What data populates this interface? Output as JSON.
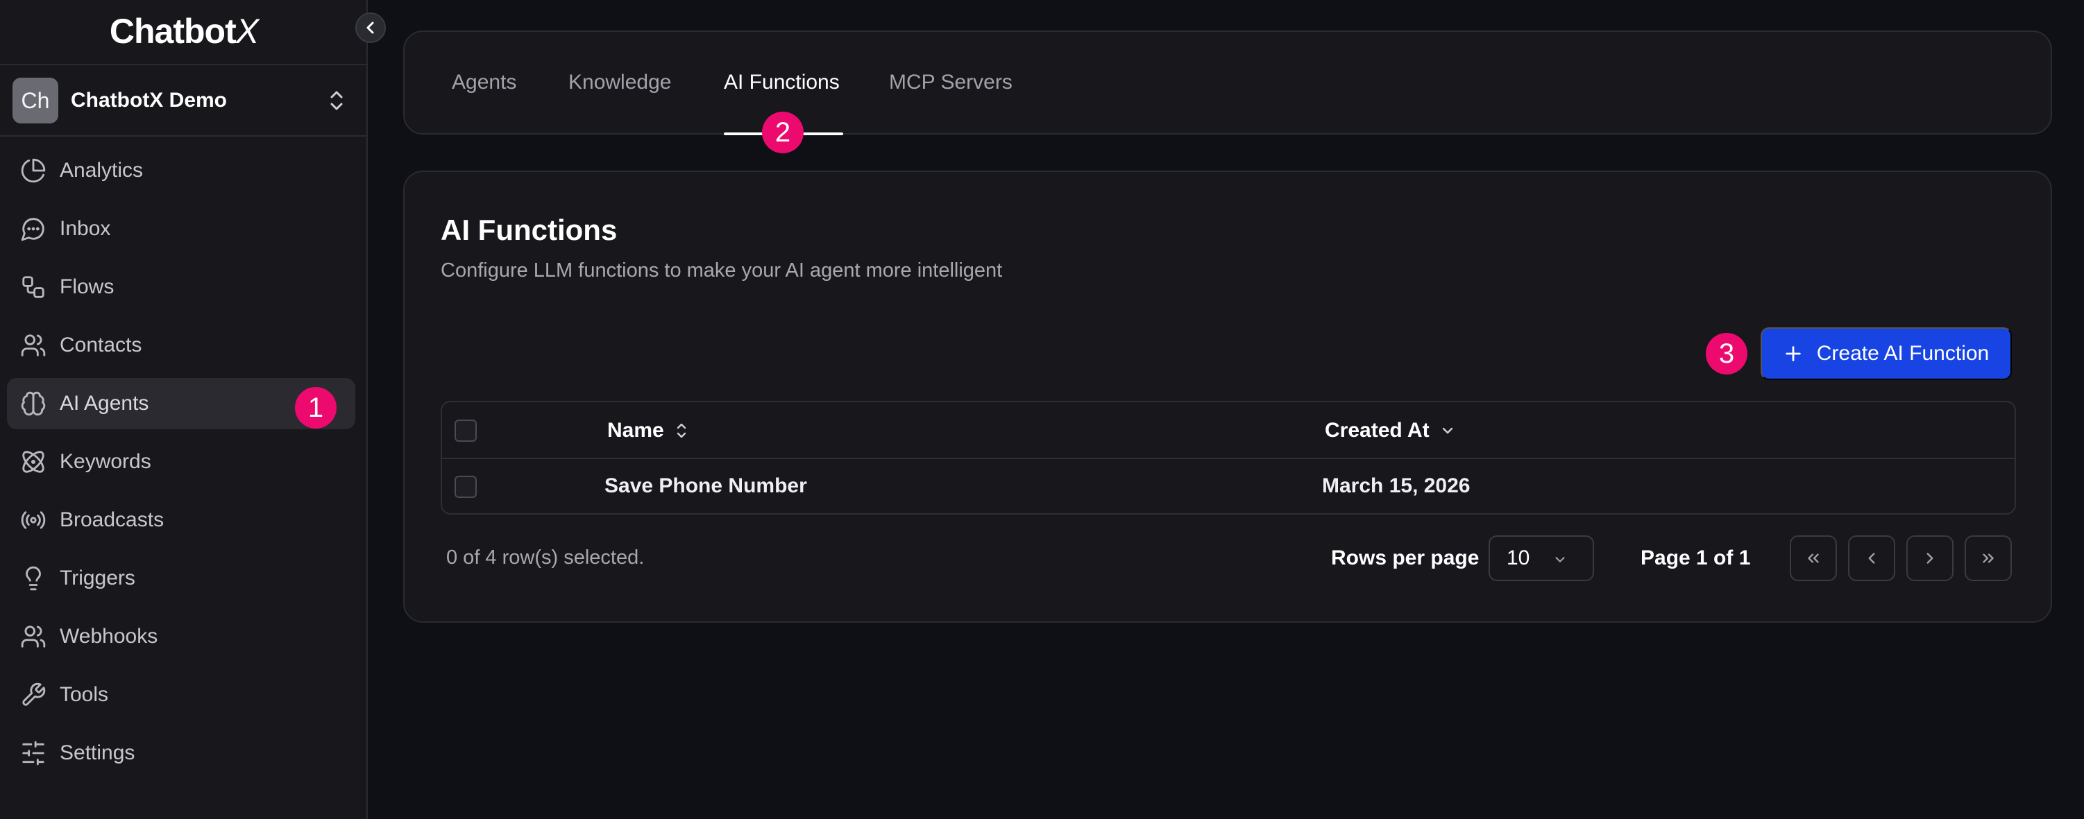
{
  "app": {
    "logo_main": "Chatbot",
    "logo_x": "X"
  },
  "workspace": {
    "avatar": "Ch",
    "name": "ChatbotX Demo"
  },
  "sidebar": {
    "items": [
      {
        "label": "Analytics",
        "icon": "pie-chart-icon"
      },
      {
        "label": "Inbox",
        "icon": "message-circle-icon"
      },
      {
        "label": "Flows",
        "icon": "workflow-icon"
      },
      {
        "label": "Contacts",
        "icon": "users-icon"
      },
      {
        "label": "AI Agents",
        "icon": "brain-icon",
        "active": true
      },
      {
        "label": "Keywords",
        "icon": "atom-icon"
      },
      {
        "label": "Broadcasts",
        "icon": "radio-icon"
      },
      {
        "label": "Triggers",
        "icon": "lightbulb-icon"
      },
      {
        "label": "Webhooks",
        "icon": "users-icon"
      },
      {
        "label": "Tools",
        "icon": "wrench-icon"
      },
      {
        "label": "Settings",
        "icon": "sliders-icon"
      }
    ]
  },
  "tabs": [
    {
      "label": "Agents"
    },
    {
      "label": "Knowledge"
    },
    {
      "label": "AI Functions",
      "active": true
    },
    {
      "label": "MCP Servers"
    }
  ],
  "annotations": {
    "badge_1": "1",
    "badge_2": "2",
    "badge_3": "3"
  },
  "main": {
    "title": "AI Functions",
    "description": "Configure LLM functions to make your AI agent more intelligent",
    "create_button": "Create AI Function",
    "table": {
      "columns": [
        "Name",
        "Created At"
      ],
      "rows": [
        {
          "name": "Save Phone Number",
          "created_at": "March 15, 2026"
        }
      ]
    },
    "footer": {
      "selection": "0 of 4 row(s) selected.",
      "rows_per_page_label": "Rows per page",
      "rows_per_page_value": "10",
      "page_info": "Page 1 of 1"
    }
  },
  "colors": {
    "accent": "#1744e3",
    "badge": "#ec0a6e",
    "background": "#0f0f16",
    "panel": "#17171c"
  }
}
